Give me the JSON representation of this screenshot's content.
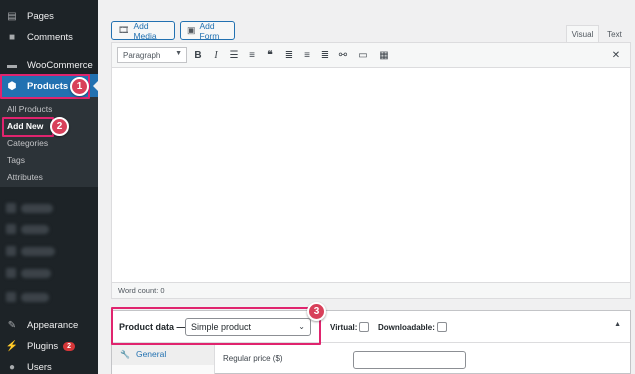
{
  "sidebar": {
    "items": [
      {
        "label": "Pages",
        "icon": "pages-icon"
      },
      {
        "label": "Comments",
        "icon": "comments-icon"
      },
      {
        "label": "WooCommerce",
        "icon": "woocommerce-icon"
      },
      {
        "label": "Products",
        "icon": "products-icon"
      },
      {
        "label": "Appearance",
        "icon": "appearance-icon"
      },
      {
        "label": "Plugins",
        "icon": "plugins-icon",
        "badge": "2"
      },
      {
        "label": "Users",
        "icon": "users-icon"
      }
    ],
    "submenu": [
      "All Products",
      "Add New",
      "Categories",
      "Tags",
      "Attributes"
    ]
  },
  "annotations": {
    "step1": "1",
    "step2": "2",
    "step3": "3",
    "highlight_color": "#e0246e"
  },
  "editor": {
    "add_media": "Add Media",
    "add_form": "Add Form",
    "tab_visual": "Visual",
    "tab_text": "Text",
    "format_value": "Paragraph",
    "word_count": "Word count: 0"
  },
  "product_data": {
    "title": "Product data —",
    "type_value": "Simple product",
    "virtual_label": "Virtual:",
    "downloadable_label": "Downloadable:",
    "tab_general": "General",
    "regular_price_label": "Regular price ($)"
  },
  "colors": {
    "accent": "#2271b1",
    "sidebar_bg": "#1d2327",
    "badge": "#d63638"
  }
}
